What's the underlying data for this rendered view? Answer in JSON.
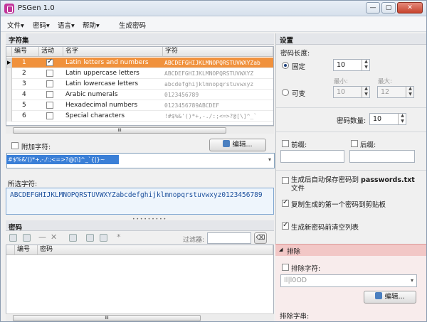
{
  "window": {
    "title": "PSGen 1.0",
    "btn_min": "—",
    "btn_max": "▢",
    "btn_close": "✕"
  },
  "menu": {
    "file": "文件▾",
    "password": "密码▾",
    "language": "语言▾",
    "help": "帮助▾",
    "generate": "生成密码"
  },
  "charsets": {
    "section_title": "字符集",
    "columns": {
      "num": "编号",
      "active": "活动",
      "name": "名字",
      "chars": "字符"
    },
    "rows": [
      {
        "num": "1",
        "active": true,
        "name": "Latin letters and numbers",
        "chars": "ABCDEFGHIJKLMNOPQRSTUVWXYZab"
      },
      {
        "num": "2",
        "active": false,
        "name": "Latin uppercase letters",
        "chars": "ABCDEFGHIJKLMNOPQRSTUVWXYZ"
      },
      {
        "num": "3",
        "active": false,
        "name": "Latin lowercase letters",
        "chars": "abcdefghijklmnopqrstuvwxyz"
      },
      {
        "num": "4",
        "active": false,
        "name": "Arabic numerals",
        "chars": "0123456789"
      },
      {
        "num": "5",
        "active": false,
        "name": "Hexadecimal numbers",
        "chars": "0123456789ABCDEF"
      },
      {
        "num": "6",
        "active": false,
        "name": "Special characters",
        "chars": "!#$%&'()*+,-./:;<=>?@[\\]^_`"
      }
    ],
    "scroll_grip": "III"
  },
  "extra": {
    "label": "附加字符:",
    "edit_button": "编辑...",
    "value": "#$%&'()*+,-./:;<=>?@[\\]^_`{|}~"
  },
  "selected": {
    "label": "所选字符:",
    "value": "ABCDEFGHIJKLMNOPQRSTUVWXYZabcdefghijklmnopqrstuvwxyz0123456789"
  },
  "passwords": {
    "section_title": "密码",
    "filter_label": "过滤器:",
    "filter_value": "",
    "col_num": "编号",
    "col_pw": "密码",
    "scroll_grip": "III"
  },
  "settings": {
    "title": "设置",
    "length_label": "密码长度:",
    "fixed_label": "固定",
    "fixed_value": "10",
    "variable_label": "可变",
    "min_label": "最小:",
    "min_value": "10",
    "max_label": "最大:",
    "max_value": "12",
    "count_label": "密码数量:",
    "count_value": "10",
    "prefix_label": "前缀:",
    "suffix_label": "后缀:",
    "prefix_value": "",
    "suffix_value": "",
    "autosave_label": "生成后自动保存密码到",
    "autosave_file": "passwords.txt",
    "autosave_tail": "文件",
    "copy_label": "复制生成的第一个密码到剪贴板",
    "clear_label": "生成新密码前清空列表",
    "exclude": {
      "title": "排除",
      "chars_label": "排除字符:",
      "chars_value": "Il|l0OD",
      "edit_button": "编辑...",
      "strings_label": "排除字串:"
    }
  },
  "colors": {
    "selection": "#f0913c",
    "accent": "#3a7fd7"
  }
}
